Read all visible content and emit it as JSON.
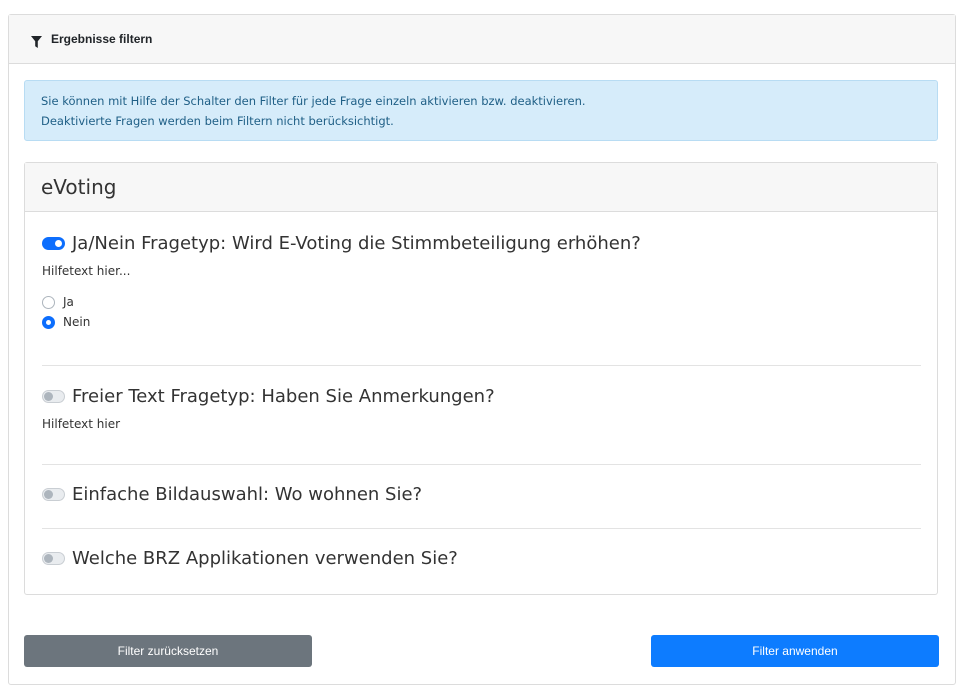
{
  "header": {
    "title": "Ergebnisse filtern",
    "icon": "funnel-icon"
  },
  "info": {
    "line1": "Sie können mit Hilfe der Schalter den Filter für jede Frage einzeln aktivieren bzw. deaktivieren.",
    "line2": "Deaktivierte Fragen werden beim Filtern nicht berücksichtigt."
  },
  "section": {
    "title": "eVoting",
    "questions": [
      {
        "text": "Ja/Nein Fragetyp: Wird E-Voting die Stimmbeteiligung erhöhen?",
        "enabled": true,
        "help": "Hilfetext hier...",
        "options": [
          {
            "label": "Ja",
            "checked": false
          },
          {
            "label": "Nein",
            "checked": true
          }
        ]
      },
      {
        "text": "Freier Text Fragetyp: Haben Sie Anmerkungen?",
        "enabled": false,
        "help": "Hilfetext hier"
      },
      {
        "text": "Einfache Bildauswahl: Wo wohnen Sie?",
        "enabled": false
      },
      {
        "text": "Welche BRZ Applikationen verwenden Sie?",
        "enabled": false
      }
    ]
  },
  "buttons": {
    "reset": "Filter zurücksetzen",
    "apply": "Filter anwenden"
  },
  "colors": {
    "primary": "#0d7cff",
    "secondary": "#6c757d",
    "info_bg": "#d6ecfa"
  }
}
